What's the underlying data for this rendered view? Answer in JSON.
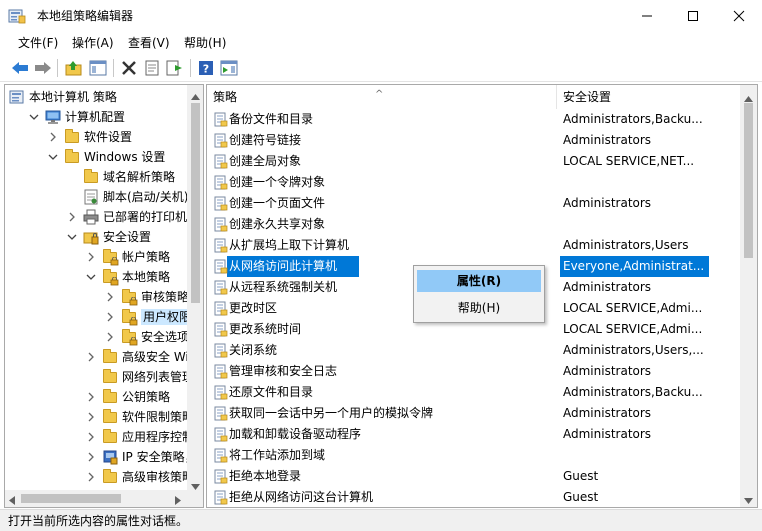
{
  "window": {
    "title": "本地组策略编辑器",
    "min_glyph": "—",
    "max_glyph": "☐",
    "close_glyph": "✕"
  },
  "menu": [
    "文件(F)",
    "操作(A)",
    "查看(V)",
    "帮助(H)"
  ],
  "toolbar": {
    "icons": [
      "back-icon",
      "forward-icon",
      "up-folder-icon",
      "show-hide-tree-icon",
      "delete-icon",
      "properties-icon",
      "export-list-icon",
      "help-icon",
      "show-action-pane-icon"
    ]
  },
  "tree": [
    {
      "label": "本地计算机 策略",
      "level": 0,
      "toggle": "",
      "icon": "policy"
    },
    {
      "label": "计算机配置",
      "level": 1,
      "toggle": "open",
      "icon": "computer"
    },
    {
      "label": "软件设置",
      "level": 2,
      "toggle": "closed",
      "icon": "folder"
    },
    {
      "label": "Windows 设置",
      "level": 2,
      "toggle": "open",
      "icon": "folder"
    },
    {
      "label": "域名解析策略",
      "level": 3,
      "toggle": "",
      "icon": "folder"
    },
    {
      "label": "脚本(启动/关机)",
      "level": 3,
      "toggle": "",
      "icon": "script"
    },
    {
      "label": "已部署的打印机",
      "level": 3,
      "toggle": "closed",
      "icon": "printer"
    },
    {
      "label": "安全设置",
      "level": 3,
      "toggle": "open",
      "icon": "security"
    },
    {
      "label": "帐户策略",
      "level": 4,
      "toggle": "closed",
      "icon": "folder"
    },
    {
      "label": "本地策略",
      "level": 4,
      "toggle": "open",
      "icon": "folder"
    },
    {
      "label": "审核策略",
      "level": 5,
      "toggle": "closed",
      "icon": "folder"
    },
    {
      "label": "用户权限分",
      "level": 5,
      "toggle": "closed",
      "icon": "folder",
      "selected": true
    },
    {
      "label": "安全选项",
      "level": 5,
      "toggle": "closed",
      "icon": "folder"
    },
    {
      "label": "高级安全 Win",
      "level": 4,
      "toggle": "closed",
      "icon": "folder"
    },
    {
      "label": "网络列表管理",
      "level": 4,
      "toggle": "",
      "icon": "folder"
    },
    {
      "label": "公钥策略",
      "level": 4,
      "toggle": "closed",
      "icon": "folder"
    },
    {
      "label": "软件限制策略",
      "level": 4,
      "toggle": "closed",
      "icon": "folder"
    },
    {
      "label": "应用程序控制",
      "level": 4,
      "toggle": "closed",
      "icon": "folder"
    },
    {
      "label": "IP 安全策略，",
      "level": 4,
      "toggle": "closed",
      "icon": "ipsec"
    },
    {
      "label": "高级审核策略",
      "level": 4,
      "toggle": "closed",
      "icon": "folder"
    }
  ],
  "list": {
    "columns": [
      "策略",
      "安全设置"
    ],
    "sort_glyph": "^",
    "rows": [
      {
        "policy": "备份文件和目录",
        "setting": "Administrators,Backu..."
      },
      {
        "policy": "创建符号链接",
        "setting": "Administrators"
      },
      {
        "policy": "创建全局对象",
        "setting": "LOCAL SERVICE,NET..."
      },
      {
        "policy": "创建一个令牌对象",
        "setting": ""
      },
      {
        "policy": "创建一个页面文件",
        "setting": "Administrators"
      },
      {
        "policy": "创建永久共享对象",
        "setting": ""
      },
      {
        "policy": "从扩展坞上取下计算机",
        "setting": "Administrators,Users"
      },
      {
        "policy": "从网络访问此计算机",
        "setting": "Everyone,Administrat...",
        "selected": true
      },
      {
        "policy": "从远程系统强制关机",
        "setting": "Administrators"
      },
      {
        "policy": "更改时区",
        "setting": "LOCAL SERVICE,Admi..."
      },
      {
        "policy": "更改系统时间",
        "setting": "LOCAL SERVICE,Admi..."
      },
      {
        "policy": "关闭系统",
        "setting": "Administrators,Users,..."
      },
      {
        "policy": "管理审核和安全日志",
        "setting": "Administrators"
      },
      {
        "policy": "还原文件和目录",
        "setting": "Administrators,Backu..."
      },
      {
        "policy": "获取同一会话中另一个用户的模拟令牌",
        "setting": "Administrators"
      },
      {
        "policy": "加载和卸载设备驱动程序",
        "setting": "Administrators"
      },
      {
        "policy": "将工作站添加到域",
        "setting": ""
      },
      {
        "policy": "拒绝本地登录",
        "setting": "Guest"
      },
      {
        "policy": "拒绝从网络访问这台计算机",
        "setting": "Guest"
      }
    ]
  },
  "context_menu": {
    "items": [
      "属性(R)",
      "帮助(H)"
    ]
  },
  "status": {
    "text": "打开当前所选内容的属性对话框。"
  },
  "colors": {
    "selection": "#0078d7",
    "menu_hover": "#91c9f7",
    "tree_selection": "#cce8ff"
  }
}
